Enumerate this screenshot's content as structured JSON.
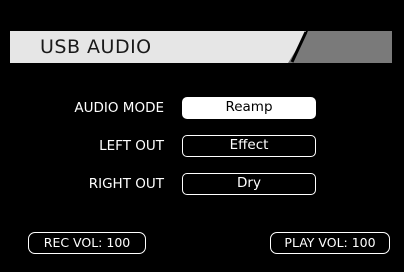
{
  "header": {
    "title": "USB AUDIO"
  },
  "settings": [
    {
      "label": "AUDIO MODE",
      "value": "Reamp",
      "selected": true
    },
    {
      "label": "LEFT OUT",
      "value": "Effect",
      "selected": false
    },
    {
      "label": "RIGHT OUT",
      "value": "Dry",
      "selected": false
    }
  ],
  "footer": {
    "rec_vol": "REC VOL: 100",
    "play_vol": "PLAY VOL: 100"
  },
  "colors": {
    "background": "#000000",
    "header_light": "#e6e6e6",
    "header_dark": "#7a7a7a",
    "text": "#ffffff",
    "selected_fill": "#ffffff"
  }
}
